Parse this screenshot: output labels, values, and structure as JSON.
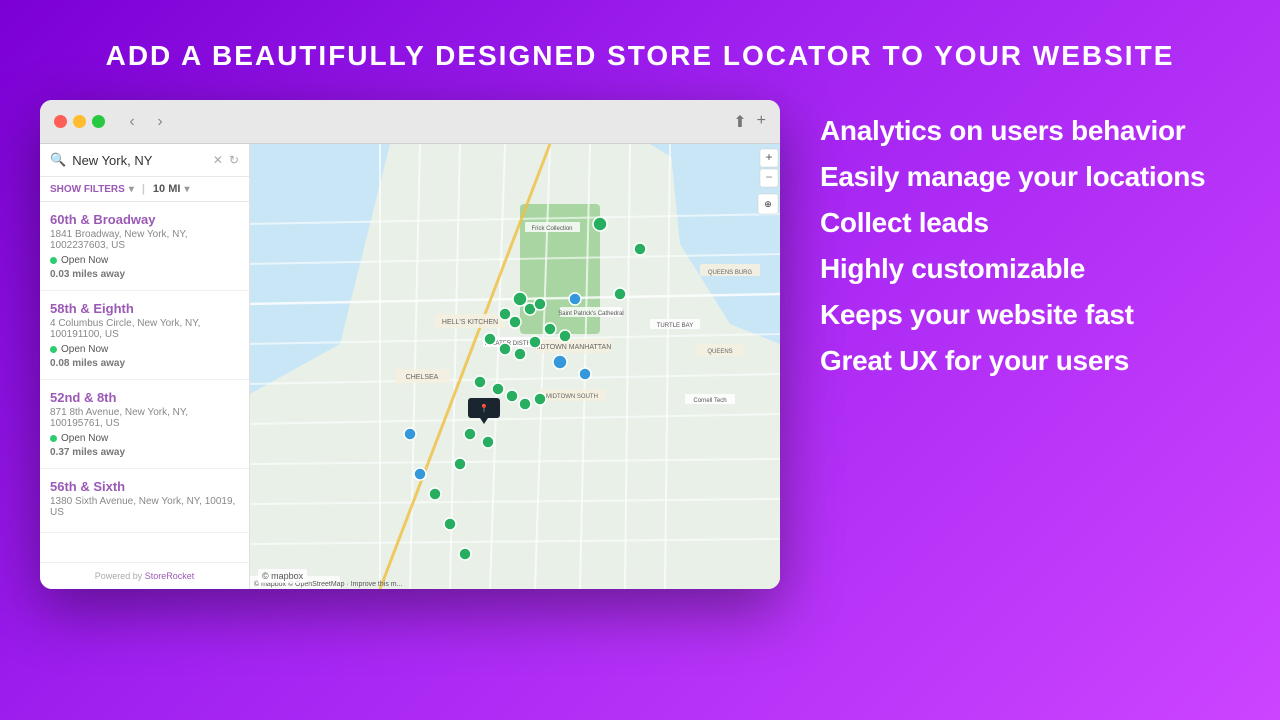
{
  "page": {
    "title": "ADD A BEAUTIFULLY DESIGNED STORE LOCATOR TO YOUR WEBSITE",
    "background_gradient": "linear-gradient(135deg, #7b00d4, #cc44ff)"
  },
  "browser": {
    "search_value": "New York, NY",
    "traffic_lights": [
      "red",
      "yellow",
      "green"
    ],
    "nav_back": "‹",
    "nav_forward": "›",
    "toolbar_share": "⬆",
    "toolbar_add": "+"
  },
  "sidebar": {
    "search_placeholder": "New York, NY",
    "filter_label": "SHOW FILTERS",
    "filter_distance": "10 MI",
    "locations": [
      {
        "name": "60th & Broadway",
        "address": "1841 Broadway, New York, NY, 1002237603, US",
        "status": "Open Now",
        "distance": "0.03 miles away"
      },
      {
        "name": "58th & Eighth",
        "address": "4 Columbus Circle, New York, NY, 100191100, US",
        "status": "Open Now",
        "distance": "0.08 miles away"
      },
      {
        "name": "52nd & 8th",
        "address": "871 8th Avenue, New York, NY, 100195761, US",
        "status": "Open Now",
        "distance": "0.37 miles away"
      },
      {
        "name": "56th & Sixth",
        "address": "1380 Sixth Avenue, New York, NY, 10019, US",
        "status": "",
        "distance": ""
      }
    ],
    "footer": "Powered by StoreRocket"
  },
  "features": [
    {
      "id": "analytics",
      "text": "Analytics on users behavior"
    },
    {
      "id": "manage",
      "text": "Easily manage your locations"
    },
    {
      "id": "leads",
      "text": "Collect leads"
    },
    {
      "id": "customizable",
      "text": "Highly customizable"
    },
    {
      "id": "fast",
      "text": "Keeps your website fast"
    },
    {
      "id": "ux",
      "text": "Great UX for your users"
    }
  ],
  "map": {
    "attribution": "© Mapbox © OpenStreetMap · Improve this m...",
    "logo": "© mapbox"
  }
}
